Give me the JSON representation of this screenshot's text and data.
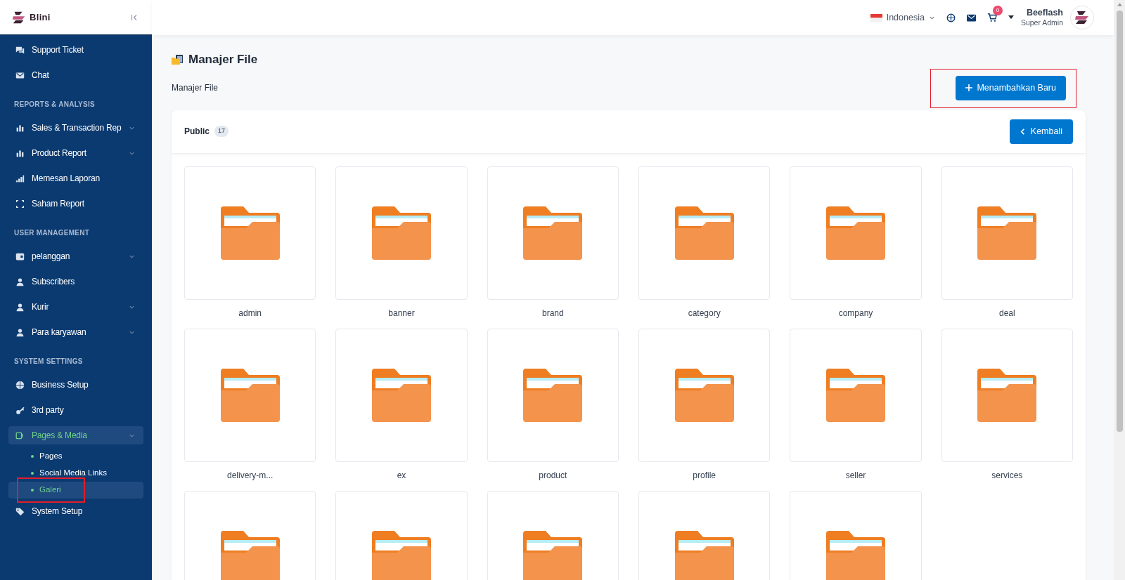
{
  "brand": {
    "name": "Blini"
  },
  "sidebar": {
    "items": [
      {
        "kind": "item",
        "label": "Support Ticket",
        "expandable": false,
        "selected": false
      },
      {
        "kind": "item",
        "label": "Chat",
        "expandable": false,
        "selected": false
      },
      {
        "kind": "header",
        "label": "REPORTS & ANALYSIS"
      },
      {
        "kind": "item",
        "label": "Sales & Transaction Rep",
        "expandable": true,
        "selected": false
      },
      {
        "kind": "item",
        "label": "Product Report",
        "expandable": true,
        "selected": false
      },
      {
        "kind": "item",
        "label": "Memesan Laporan",
        "expandable": false,
        "selected": false
      },
      {
        "kind": "item",
        "label": "Saham Report",
        "expandable": false,
        "selected": false
      },
      {
        "kind": "header",
        "label": "USER MANAGEMENT"
      },
      {
        "kind": "item",
        "label": "pelanggan",
        "expandable": true,
        "selected": false
      },
      {
        "kind": "item",
        "label": "Subscribers",
        "expandable": false,
        "selected": false
      },
      {
        "kind": "item",
        "label": "Kurir",
        "expandable": true,
        "selected": false
      },
      {
        "kind": "item",
        "label": "Para karyawan",
        "expandable": true,
        "selected": false
      },
      {
        "kind": "header",
        "label": "SYSTEM SETTINGS"
      },
      {
        "kind": "item",
        "label": "Business Setup",
        "expandable": false,
        "selected": false
      },
      {
        "kind": "item",
        "label": "3rd party",
        "expandable": false,
        "selected": false
      },
      {
        "kind": "item",
        "label": "Pages & Media",
        "expandable": true,
        "selected": true,
        "children": [
          {
            "label": "Pages",
            "selected": false
          },
          {
            "label": "Social Media Links",
            "selected": false
          },
          {
            "label": "Galeri",
            "selected": true,
            "highlighted": true
          }
        ]
      },
      {
        "kind": "item",
        "label": "System Setup",
        "expandable": false,
        "selected": false
      }
    ]
  },
  "topbar": {
    "language": "Indonesia",
    "cart_count": "0",
    "user_name": "Beeflash",
    "user_role": "Super Admin"
  },
  "page": {
    "title": "Manajer File",
    "subtitle": "Manajer File",
    "add_button": {
      "label": "Menambahkan Baru",
      "highlighted": true
    }
  },
  "folder_panel": {
    "title": "Public",
    "count": "17",
    "back_button": "Kembali",
    "folders": [
      {
        "kind": "folder",
        "name": "admin"
      },
      {
        "kind": "folder",
        "name": "banner"
      },
      {
        "kind": "folder",
        "name": "brand"
      },
      {
        "kind": "folder",
        "name": "category"
      },
      {
        "kind": "folder",
        "name": "company"
      },
      {
        "kind": "folder",
        "name": "deal"
      },
      {
        "kind": "folder",
        "name": "delivery-m..."
      },
      {
        "kind": "folder",
        "name": "ex"
      },
      {
        "kind": "folder",
        "name": "product"
      },
      {
        "kind": "folder",
        "name": "profile"
      },
      {
        "kind": "folder",
        "name": "seller"
      },
      {
        "kind": "folder",
        "name": "services"
      },
      {
        "kind": "folder"
      },
      {
        "kind": "folder"
      },
      {
        "kind": "folder"
      },
      {
        "kind": "folder"
      },
      {
        "kind": "folder"
      }
    ]
  }
}
